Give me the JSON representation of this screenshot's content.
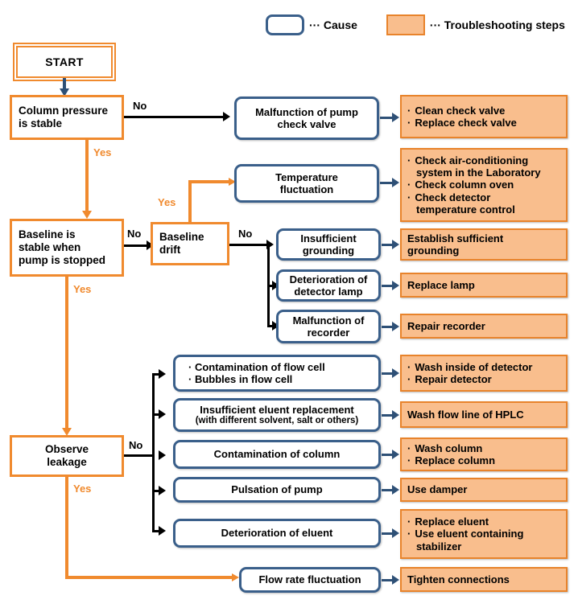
{
  "legend": {
    "cause_label": "··· Cause",
    "steps_label": "··· Troubleshooting steps",
    "cause_color": "#3A5F8A",
    "steps_color": "#F9BE8D",
    "steps_border": "#E8832B"
  },
  "start": {
    "label": "START"
  },
  "decisions": [
    {
      "id": "column-pressure",
      "line1": "Column pressure",
      "line2": "is stable",
      "line3": "",
      "no": "No",
      "yes": "Yes"
    },
    {
      "id": "baseline-stable",
      "line1": "Baseline is",
      "line2": "stable when",
      "line3": "pump is stopped",
      "no": "No",
      "yes": "Yes"
    },
    {
      "id": "baseline-drift",
      "line1": "Baseline",
      "line2": "drift",
      "line3": "",
      "no": "No",
      "yes": "Yes"
    },
    {
      "id": "observe-leakage",
      "line1": "Observe",
      "line2": "leakage",
      "line3": "",
      "no": "No",
      "yes": "Yes"
    }
  ],
  "causes": [
    {
      "id": "pump-check-valve",
      "l1": "Malfunction of pump",
      "l2": "check valve"
    },
    {
      "id": "temperature-fluctuation",
      "l1": "Temperature",
      "l2": "fluctuation"
    },
    {
      "id": "insufficient-grounding",
      "l1": "Insufficient",
      "l2": "grounding"
    },
    {
      "id": "detector-lamp",
      "l1": "Deterioration of",
      "l2": "detector lamp"
    },
    {
      "id": "malfunction-recorder",
      "l1": "Malfunction of",
      "l2": "recorder"
    },
    {
      "id": "flow-cell",
      "l1": "· Contamination of flow cell",
      "l2": "· Bubbles in flow cell"
    },
    {
      "id": "eluent-replacement",
      "l1": "Insufficient eluent replacement",
      "l2": "(with different solvent, salt or others)"
    },
    {
      "id": "contamination-column",
      "l1": "Contamination of column",
      "l2": ""
    },
    {
      "id": "pulsation-pump",
      "l1": "Pulsation of pump",
      "l2": ""
    },
    {
      "id": "deterioration-eluent",
      "l1": "Deterioration of eluent",
      "l2": ""
    },
    {
      "id": "flow-rate-fluctuation",
      "l1": "Flow rate fluctuation",
      "l2": ""
    }
  ],
  "steps": [
    {
      "id": "check-valve-steps",
      "items": [
        "Clean check valve",
        "Replace check valve"
      ],
      "bullets": true
    },
    {
      "id": "temperature-steps",
      "items": [
        "Check air-conditioning",
        "system in the Laboratory",
        "Check column oven",
        "Check detector",
        "temperature control"
      ],
      "bullets": true,
      "bullet_flags": [
        true,
        false,
        true,
        true,
        false
      ]
    },
    {
      "id": "grounding-steps",
      "items": [
        "Establish sufficient",
        "grounding"
      ],
      "bullets": false
    },
    {
      "id": "lamp-steps",
      "items": [
        "Replace lamp"
      ],
      "bullets": false
    },
    {
      "id": "recorder-steps",
      "items": [
        "Repair recorder"
      ],
      "bullets": false
    },
    {
      "id": "detector-steps",
      "items": [
        "Wash inside of detector",
        "Repair detector"
      ],
      "bullets": true
    },
    {
      "id": "flow-line-steps",
      "items": [
        "Wash flow line of HPLC"
      ],
      "bullets": false
    },
    {
      "id": "column-steps",
      "items": [
        "Wash column",
        "Replace column"
      ],
      "bullets": true
    },
    {
      "id": "damper-steps",
      "items": [
        "Use damper"
      ],
      "bullets": false
    },
    {
      "id": "eluent-steps",
      "items": [
        "Replace eluent",
        "Use eluent containing",
        "stabilizer"
      ],
      "bullets": true,
      "bullet_flags": [
        true,
        true,
        false
      ]
    },
    {
      "id": "connections-steps",
      "items": [
        "Tighten connections"
      ],
      "bullets": false
    }
  ],
  "edge_labels": {
    "no1": "No",
    "yes1": "Yes",
    "no2": "No",
    "yes2": "Yes",
    "no3": "No",
    "yes3": "Yes",
    "no4": "No",
    "yes4": "Yes"
  },
  "colors": {
    "orange_line": "#F08A2E",
    "black_line": "#000000",
    "navy_arrow": "#2E5076",
    "steps_fill": "#F9BE8D"
  }
}
